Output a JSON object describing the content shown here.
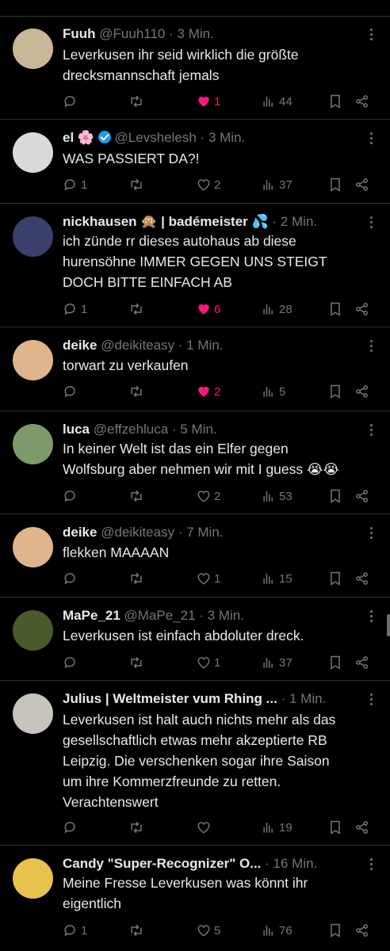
{
  "posts": [
    {
      "name": "Fuuh",
      "handle": "@Fuuh110",
      "time": "3 Min.",
      "text": [
        "Leverkusen ihr seid wirklich die größte",
        "drecksmannschaft jemals"
      ],
      "replies": "",
      "likes": "1",
      "liked": true,
      "views": "44",
      "avatar_color": "#c9b79a"
    },
    {
      "name": "el 🌸",
      "verified": true,
      "handle": "@Levshelesh",
      "time": "3 Min.",
      "text": [
        "WAS PASSIERT DA?!"
      ],
      "replies": "1",
      "likes": "2",
      "liked": false,
      "views": "37",
      "avatar_color": "#d9d9d9"
    },
    {
      "name": "nickhausen 🙊 | badémeister 💦",
      "handle": "",
      "time": "2 Min.",
      "text": [
        "ich zünde rr dieses autohaus ab diese",
        "hurensöhne IMMER GEGEN UNS STEIGT",
        "DOCH BITTE EINFACH AB"
      ],
      "replies": "1",
      "likes": "6",
      "liked": true,
      "views": "28",
      "avatar_color": "#3a3f6b"
    },
    {
      "name": "deike",
      "handle": "@deikiteasy",
      "time": "1 Min.",
      "text": [
        "torwart zu verkaufen"
      ],
      "replies": "",
      "likes": "2",
      "liked": true,
      "views": "5",
      "avatar_color": "#e0b58c"
    },
    {
      "name": "luca",
      "handle": "@effzehluca",
      "time": "5 Min.",
      "text": [
        "In keiner Welt ist das ein Elfer gegen",
        "Wolfsburg aber nehmen wir mit I guess 😭😭"
      ],
      "replies": "",
      "likes": "2",
      "liked": false,
      "views": "53",
      "avatar_color": "#7f9a6a"
    },
    {
      "name": "deike",
      "handle": "@deikiteasy",
      "time": "7 Min.",
      "text": [
        "flekken MAAAAN"
      ],
      "replies": "",
      "likes": "1",
      "liked": false,
      "views": "15",
      "avatar_color": "#e0b58c"
    },
    {
      "name": "MaPe_21",
      "handle": "@MaPe_21",
      "time": "3 Min.",
      "text": [
        "Leverkusen ist einfach abdoluter dreck."
      ],
      "replies": "",
      "likes": "1",
      "liked": false,
      "views": "37",
      "avatar_color": "#4a5a2a"
    },
    {
      "name": "Julius | Weltmeister vum Rhing ...",
      "handle": "",
      "time": "1 Min.",
      "text": [
        "Leverkusen ist halt auch nichts mehr als das",
        "gesellschaftlich etwas mehr akzeptierte RB",
        "Leipzig. Die verschenken sogar ihre Saison",
        "um ihre Kommerzfreunde zu retten.",
        "Verachtenswert"
      ],
      "replies": "",
      "likes": "",
      "liked": false,
      "views": "19",
      "avatar_color": "#c7c3bd"
    },
    {
      "name": "Candy \"Super-Recognizer\" O...",
      "handle": "",
      "time": "16 Min.",
      "text": [
        "Meine Fresse Leverkusen was könnt ihr",
        "eigentlich"
      ],
      "replies": "1",
      "likes": "5",
      "liked": false,
      "views": "76",
      "avatar_color": "#e8c24a"
    }
  ]
}
